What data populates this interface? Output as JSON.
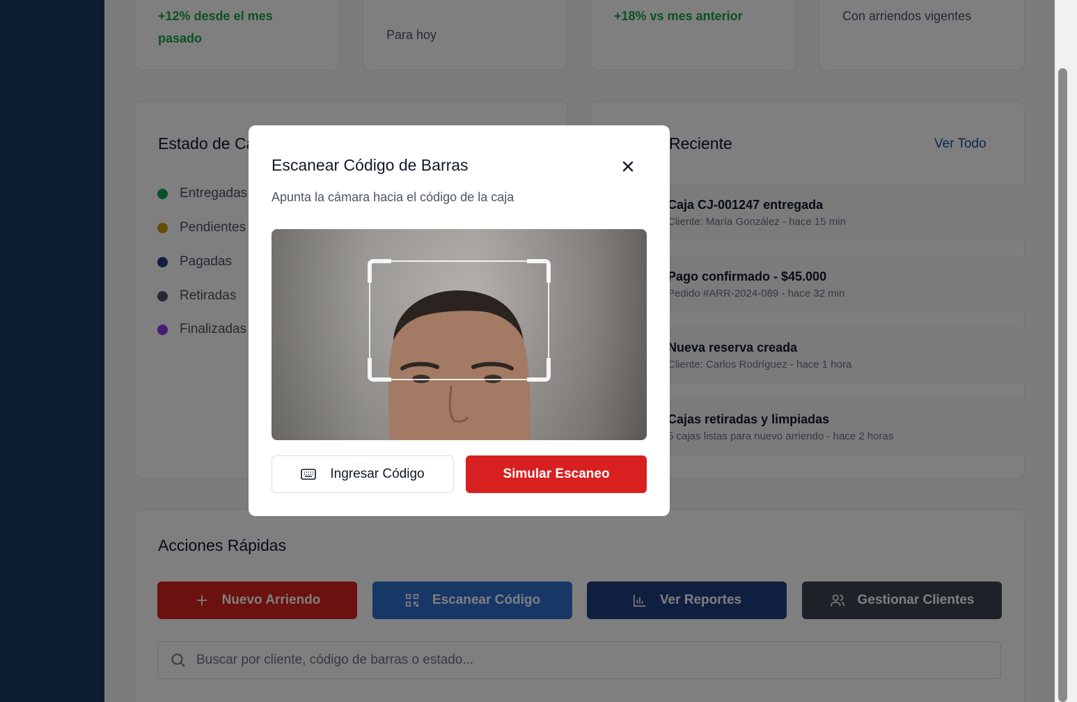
{
  "stats": [
    {
      "sub": "+12% desde el mes pasado",
      "sub_tone": "green"
    },
    {
      "sub": "Para hoy",
      "sub_tone": "gray"
    },
    {
      "sub": "+18% vs mes anterior",
      "sub_tone": "green"
    },
    {
      "sub": "Con arriendos vigentes",
      "sub_tone": "gray"
    }
  ],
  "status_card": {
    "title": "Estado de Ca",
    "items": [
      {
        "label": "Entregadas",
        "color": "#16a34a"
      },
      {
        "label": "Pendientes",
        "color": "#ca9a04"
      },
      {
        "label": "Pagadas",
        "color": "#1e3a8a"
      },
      {
        "label": "Retiradas",
        "color": "#4b5563"
      },
      {
        "label": "Finalizadas",
        "color": "#9333ea"
      }
    ]
  },
  "activity": {
    "title": "ad Reciente",
    "view_all": "Ver Todo",
    "items": [
      {
        "title": "Caja CJ-001247 entregada",
        "sub": "Cliente: María González - hace 15 min"
      },
      {
        "title": "Pago confirmado - $45.000",
        "sub": "Pedido #ARR-2024-089 - hace 32 min"
      },
      {
        "title": "Nueva reserva creada",
        "sub": "Cliente: Carlos Rodríguez - hace 1 hora"
      },
      {
        "title": "Cajas retiradas y limpiadas",
        "sub": "5 cajas listas para nuevo arriendo - hace 2 horas"
      }
    ]
  },
  "quick_actions": {
    "title": "Acciones Rápidas",
    "buttons": [
      {
        "label": "Nuevo Arriendo",
        "icon": "plus-icon",
        "color": "#d92020"
      },
      {
        "label": "Escanear Código",
        "icon": "qr-code-icon",
        "color": "#2f6fcf"
      },
      {
        "label": "Ver Reportes",
        "icon": "bar-chart-icon",
        "color": "#1e3f80"
      },
      {
        "label": "Gestionar Clientes",
        "icon": "users-icon",
        "color": "#3d4450"
      }
    ],
    "search_placeholder": "Buscar por cliente, código de barras o estado..."
  },
  "modal": {
    "title": "Escanear Código de Barras",
    "subtitle": "Apunta la cámara hacia el código de la caja",
    "manual_button": "Ingresar Código",
    "simulate_button": "Simular Escaneo"
  },
  "colors": {
    "sidebar": "#1e3a66",
    "accent_red": "#d92020",
    "link_blue": "#1e4d9a"
  }
}
